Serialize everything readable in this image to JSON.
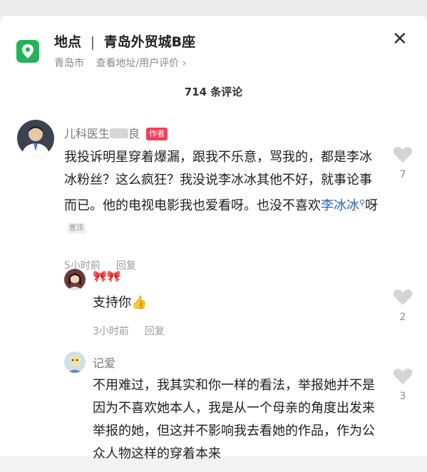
{
  "location": {
    "label": "地点",
    "separator": "|",
    "name": "青岛外贸城B座",
    "city": "青岛市",
    "links": "查看地址/用户评价 ›",
    "close": "✕",
    "accent": "#22b45b"
  },
  "comments_count": "714 条评论",
  "comments": [
    {
      "author": "儿科医生",
      "author_suffix": "良",
      "tag": "作者",
      "text_main": "我投诉明星穿着爆漏，跟我不乐意，骂我的，都是李冰冰粉丝？这么疯狂？我没说李冰冰其他不好，就事论事而已。他的电视电影我也爱看呀。也没不喜欢",
      "text_link": "李冰冰",
      "text_end": "呀",
      "pinned": "置顶",
      "time": "5小时前",
      "reply": "回复",
      "likes": "7"
    },
    {
      "author": "🎀🎀",
      "text": "支持你👍",
      "time": "3小时前",
      "reply": "回复",
      "likes": "2"
    },
    {
      "author": "记爱",
      "text": "不用难过，我其实和你一样的看法，举报她并不是因为不喜欢她本人，我是从一个母亲的角度出发来举报的她，但这并不影响我去看她的作品，作为公众人物这样的穿着本来",
      "likes": "3"
    }
  ]
}
